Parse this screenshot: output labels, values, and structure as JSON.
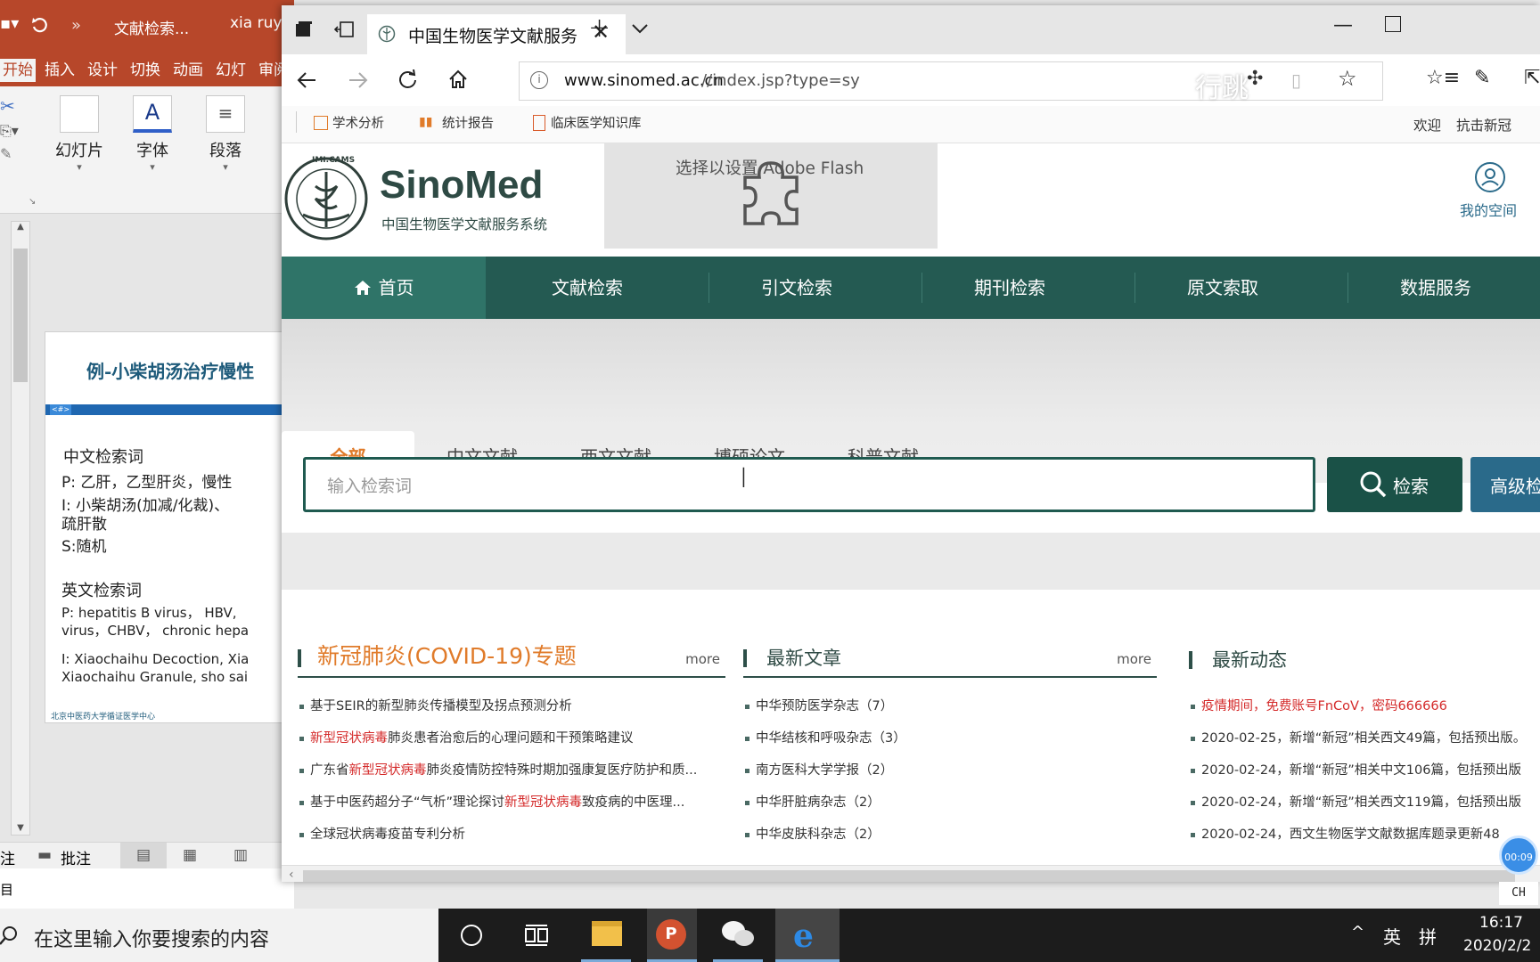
{
  "ppt": {
    "title_doc": "文献检索...",
    "title_user": "xia ruy",
    "quick_chevron": "»",
    "tabs": [
      "开始",
      "插入",
      "设计",
      "切换",
      "动画",
      "幻灯",
      "审阅"
    ],
    "ribbon": {
      "slides": "幻灯片",
      "font": "字体",
      "paragraph": "段落"
    },
    "slide": {
      "heading": "例-小柴胡汤治疗慢性",
      "tag": "<#>",
      "cn_label": "中文检索词",
      "cn_p": "P: 乙肝，乙型肝炎，慢性",
      "cn_i1": "I: 小柴胡汤(加减/化裁)、",
      "cn_i2": "疏肝散",
      "cn_s": "S:随机",
      "en_label": "英文检索词",
      "en_p1": "P:  hepatitis B virus，  HBV,",
      "en_p2": "virus，CHBV，  chronic hepa",
      "en_i1": "I: Xiaochaihu Decoction,  Xia",
      "en_i2": "Xiaochaihu Granule,  sho sai",
      "footer": "北京中医药大学循证医学中心"
    },
    "status": {
      "notes": "注",
      "comments": "批注"
    },
    "status2": "目"
  },
  "browser": {
    "tab_title": "中国生物医学文献服务系",
    "url_domain": "www.sinomed.ac.cn",
    "url_path": "//index.jsp?type=sy",
    "overlay_text": "行跳",
    "favorites": [
      "学术分析",
      "统计报告",
      "临床医学知识库"
    ],
    "top_right": [
      "欢迎",
      "抗击新冠"
    ]
  },
  "site": {
    "logo_name": "SinoMed",
    "logo_sub": "中国生物医学文献服务系统",
    "logo_seal": "IMI.CAMS",
    "flash_text": "选择以设置 Adobe Flash",
    "my_space": "我的空间",
    "nav": [
      "首页",
      "文献检索",
      "引文检索",
      "期刊检索",
      "原文索取",
      "数据服务"
    ],
    "search_tabs": [
      "全部",
      "中文文献",
      "西文文献",
      "博硕论文",
      "科普文献"
    ],
    "search_placeholder": "输入检索词",
    "search_button": "检索",
    "advanced_button": "高级检",
    "columns": [
      {
        "title": "新冠肺炎(COVID-19)专题",
        "more": "more",
        "items": [
          {
            "parts": [
              {
                "t": "基于SEIR的新型肺炎传播模型及拐点预测分析",
                "r": false
              }
            ]
          },
          {
            "parts": [
              {
                "t": "新型冠状病毒",
                "r": true
              },
              {
                "t": "肺炎患者治愈后的心理问题和干预策略建议",
                "r": false
              }
            ]
          },
          {
            "parts": [
              {
                "t": "广东省",
                "r": false
              },
              {
                "t": "新型冠状病毒",
                "r": true
              },
              {
                "t": "肺炎疫情防控特殊时期加强康复医疗防护和质...",
                "r": false
              }
            ]
          },
          {
            "parts": [
              {
                "t": "基于中医药超分子“气析”理论探讨",
                "r": false
              },
              {
                "t": "新型冠状病毒",
                "r": true
              },
              {
                "t": "致疫病的中医理...",
                "r": false
              }
            ]
          },
          {
            "parts": [
              {
                "t": "全球冠状病毒疫苗专利分析",
                "r": false
              }
            ]
          }
        ]
      },
      {
        "title": "最新文章",
        "more": "more",
        "items": [
          {
            "parts": [
              {
                "t": "中华预防医学杂志（7）",
                "r": false
              }
            ]
          },
          {
            "parts": [
              {
                "t": "中华结核和呼吸杂志（3）",
                "r": false
              }
            ]
          },
          {
            "parts": [
              {
                "t": "南方医科大学学报（2）",
                "r": false
              }
            ]
          },
          {
            "parts": [
              {
                "t": "中华肝脏病杂志（2）",
                "r": false
              }
            ]
          },
          {
            "parts": [
              {
                "t": "中华皮肤科杂志（2）",
                "r": false
              }
            ]
          }
        ]
      },
      {
        "title": "最新动态",
        "more": "",
        "items": [
          {
            "parts": [
              {
                "t": "疫情期间，免费账号FnCoV，密码666666",
                "r": true
              }
            ]
          },
          {
            "parts": [
              {
                "t": "2020-02-25，新增“新冠”相关西文49篇，包括预出版。",
                "r": false
              }
            ]
          },
          {
            "parts": [
              {
                "t": "2020-02-24，新增“新冠”相关中文106篇，包括预出版",
                "r": false
              }
            ]
          },
          {
            "parts": [
              {
                "t": "2020-02-24，新增“新冠”相关西文119篇，包括预出版",
                "r": false
              }
            ]
          },
          {
            "parts": [
              {
                "t": "2020-02-24，西文生物医学文献数据库题录更新48",
                "r": false
              }
            ]
          }
        ]
      }
    ]
  },
  "recorder": {
    "timer": "00:09",
    "ime": "CH"
  },
  "taskbar": {
    "search_placeholder": "在这里输入你要搜索的内容",
    "lang": "英",
    "ime": "拼",
    "time": "16:17",
    "date": "2020/2/2"
  },
  "colors": {
    "nav": "#245a52",
    "accent_orange": "#e07b2a",
    "ppt_red": "#b7472a",
    "search_btn": "#1a5147",
    "adv_btn": "#2a6a8a"
  }
}
